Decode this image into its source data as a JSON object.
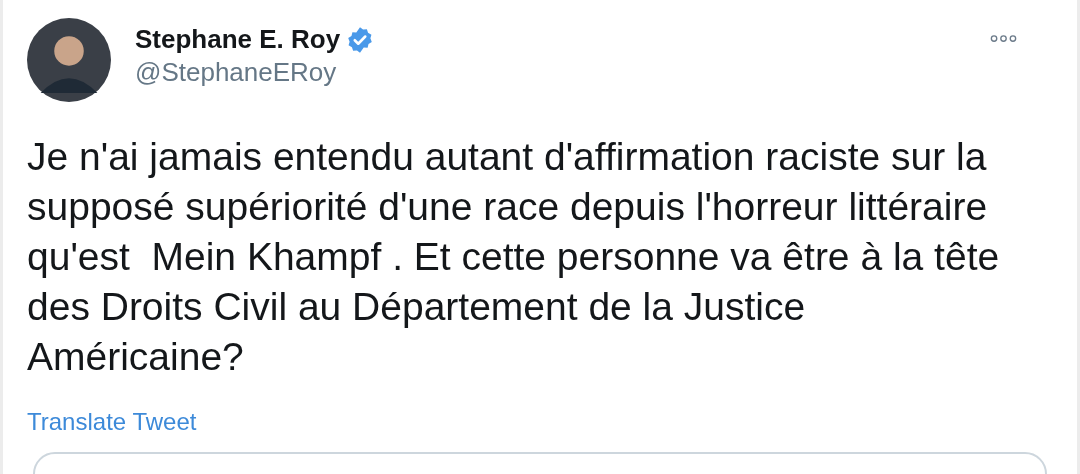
{
  "author": {
    "name": "Stephane E. Roy",
    "verified": true,
    "handle": "@StephaneERoy"
  },
  "text": "Je n'ai jamais entendu autant d'affirmation raciste sur la\nsupposé supériorité d'une race depuis l'horreur littéraire\nqu'est  Mein Khampf . Et cette personne va être à la tête\ndes Droits Civil au Département de la Justice\nAméricaine?",
  "translate_link": "Translate Tweet"
}
